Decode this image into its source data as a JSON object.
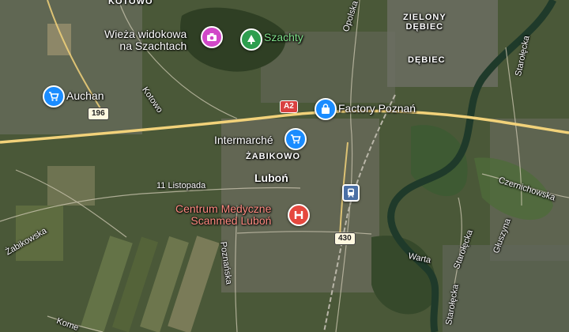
{
  "map": {
    "labels": {
      "kotowo_top": "KOTOWO",
      "zielony_debiec": "ZIELONY\nDĘBIEC",
      "debiec": "DĘBIEC",
      "kotowo_road": "Kotowo",
      "opolska": "Opolska",
      "starolecka_top": "Starołęcka",
      "zabikowo": "ŻABIKOWO",
      "lubon": "Luboń",
      "listopada": "11 Listopada",
      "zabikowska": "Żabikowska",
      "poznanska": "Poznańska",
      "czernichowska": "Czernichowska",
      "starolecka_mid": "Starołęcka",
      "gluszyna": "Głuszyna",
      "warta": "Warta",
      "starolecka_bottom": "Starołęcka",
      "kome": "Kome"
    },
    "pois": {
      "wieza": "Wieża widokowa\nna Szachtach",
      "szachty": "Szachty",
      "auchan": "Auchan",
      "factory": "Factory Poznań",
      "intermarche": "Intermarché",
      "scanmed": "Centrum Medyczne\nScanmed Luboń"
    },
    "shields": {
      "a2": "A2",
      "r196": "196",
      "r430": "430"
    },
    "colors": {
      "shopping_pin": "#1a8cff",
      "viewpoint_pin": "#d147c8",
      "park_pin": "#2e9e4f",
      "medical_pin": "#e5483f",
      "motorway": "#f2d27a"
    }
  }
}
